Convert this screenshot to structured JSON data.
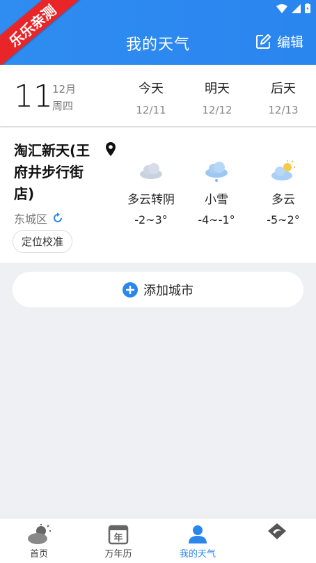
{
  "badge": "乐乐亲测",
  "header": {
    "title": "我的天气",
    "edit_label": "编辑"
  },
  "date": {
    "day": "11",
    "month": "12月",
    "weekday": "周四",
    "columns": [
      {
        "name": "今天",
        "date": "12/11"
      },
      {
        "name": "明天",
        "date": "12/12"
      },
      {
        "name": "后天",
        "date": "12/13"
      }
    ]
  },
  "city": {
    "name": "淘汇新天(王府井步行街店)",
    "district": "东城区",
    "calibrate_label": "定位校准",
    "forecast": [
      {
        "condition": "多云转阴",
        "temp": "-2~3°",
        "icon": "cloudy-icon"
      },
      {
        "condition": "小雪",
        "temp": "-4~-1°",
        "icon": "snow-icon"
      },
      {
        "condition": "多云",
        "temp": "-5~2°",
        "icon": "partly-cloudy-icon"
      }
    ]
  },
  "add_city_label": "添加城市",
  "tabs": [
    {
      "label": "首页",
      "icon": "home-weather-icon"
    },
    {
      "label": "万年历",
      "icon": "calendar-icon"
    },
    {
      "label": "我的天气",
      "icon": "user-icon"
    },
    {
      "label": "",
      "icon": "discover-icon"
    }
  ],
  "colors": {
    "accent": "#2a86ef",
    "badge": "#e8262a"
  }
}
